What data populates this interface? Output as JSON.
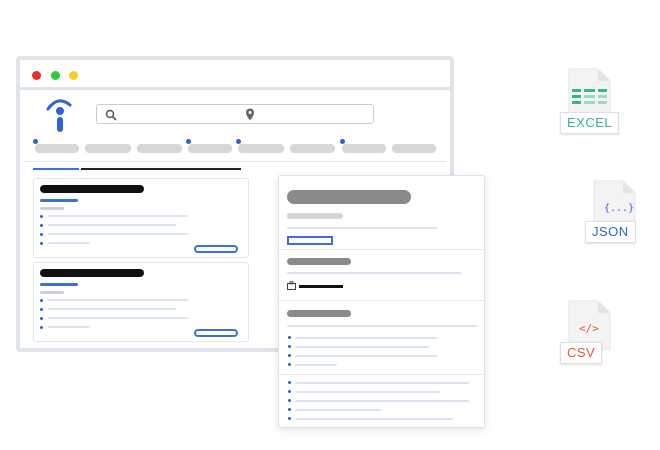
{
  "exports": {
    "excel_label": "EXCEL",
    "json_label": "JSON",
    "json_glyph": "{...}",
    "csv_label": "CSV",
    "csv_glyph": "</>"
  },
  "icons": {
    "logo": "indeed-logo",
    "search": "search-icon",
    "location": "location-pin-icon",
    "briefcase": "briefcase-icon"
  },
  "colors": {
    "accent_blue": "#3a6fe0",
    "excel_green": "#35b88a",
    "json_blue": "#2a63d6",
    "csv_orange": "#e0583a",
    "window_red": "#ef2b2b",
    "window_green": "#2bcc3c",
    "window_yellow": "#f4d01a"
  }
}
